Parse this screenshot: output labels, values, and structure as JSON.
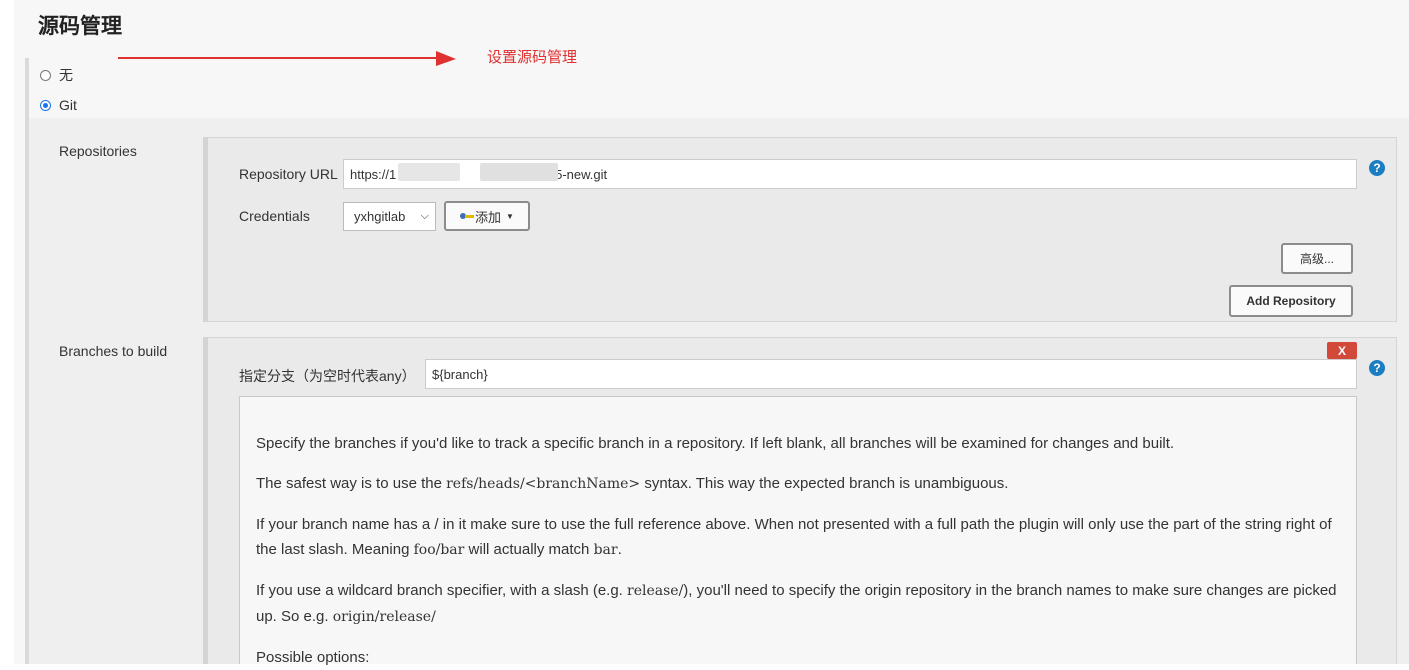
{
  "section": {
    "title": "源码管理"
  },
  "annotation": {
    "text": "设置源码管理",
    "color": "#e03030"
  },
  "scm_options": [
    {
      "label": "无",
      "selected": false
    },
    {
      "label": "Git",
      "selected": true
    }
  ],
  "repositories": {
    "label": "Repositories",
    "url_label": "Repository URL",
    "url_value_start": "https://1",
    "url_value_end": "/h5-new.git",
    "credentials_label": "Credentials",
    "credentials_selected": "yxhgitlab",
    "add_button_label": "添加",
    "advanced_button_label": "高级...",
    "add_repository_button_label": "Add Repository"
  },
  "branches": {
    "label": "Branches to build",
    "delete_label": "X",
    "specifier_label": "指定分支（为空时代表any）",
    "specifier_value": "${branch}",
    "help": {
      "p1": "Specify the branches if you'd like to track a specific branch in a repository. If left blank, all branches will be examined for changes and built.",
      "p2_a": "The safest way is to use the ",
      "p2_code": "refs/heads/<branchName>",
      "p2_b": " syntax. This way the expected branch is unambiguous.",
      "p3_a": "If your branch name has a / in it make sure to use the full reference above. When not presented with a full path the plugin will only use the part of the string right of the last slash. Meaning ",
      "p3_code1": "foo/bar",
      "p3_b": " will actually match ",
      "p3_code2": "bar",
      "p3_c": ".",
      "p4_a": "If you use a wildcard branch specifier, with a slash (e.g. ",
      "p4_code1": "release/",
      "p4_b": "), you'll need to specify the origin repository in the branch names to make sure changes are picked up. So e.g. ",
      "p4_code2": "origin/release/",
      "p5": "Possible options:"
    }
  },
  "icons": {
    "help": "help-icon",
    "key": "key-icon"
  },
  "colors": {
    "accent": "#1b7ec2",
    "delete": "#d24939"
  }
}
